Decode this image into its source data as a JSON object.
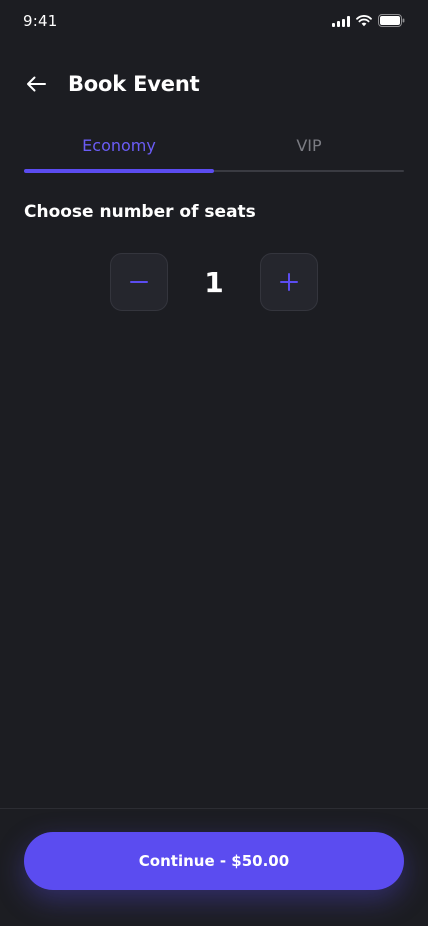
{
  "status_bar": {
    "time": "9:41",
    "icons": [
      "signal-icon",
      "wifi-icon",
      "battery-icon"
    ]
  },
  "header": {
    "back_icon": "arrow-left-icon",
    "title": "Book Event"
  },
  "tabs": {
    "items": [
      {
        "label": "Economy",
        "active": true
      },
      {
        "label": "VIP",
        "active": false
      }
    ]
  },
  "seats": {
    "title": "Choose number of seats",
    "value": "1",
    "minus_icon": "minus-icon",
    "plus_icon": "plus-icon"
  },
  "footer": {
    "continue_label": "Continue - $50.00"
  },
  "colors": {
    "background": "#1c1d22",
    "accent": "#5b4cf0",
    "accent_text": "#6a5cf5",
    "inactive_text": "#7b7c83",
    "stepper_bg": "#25262d"
  }
}
